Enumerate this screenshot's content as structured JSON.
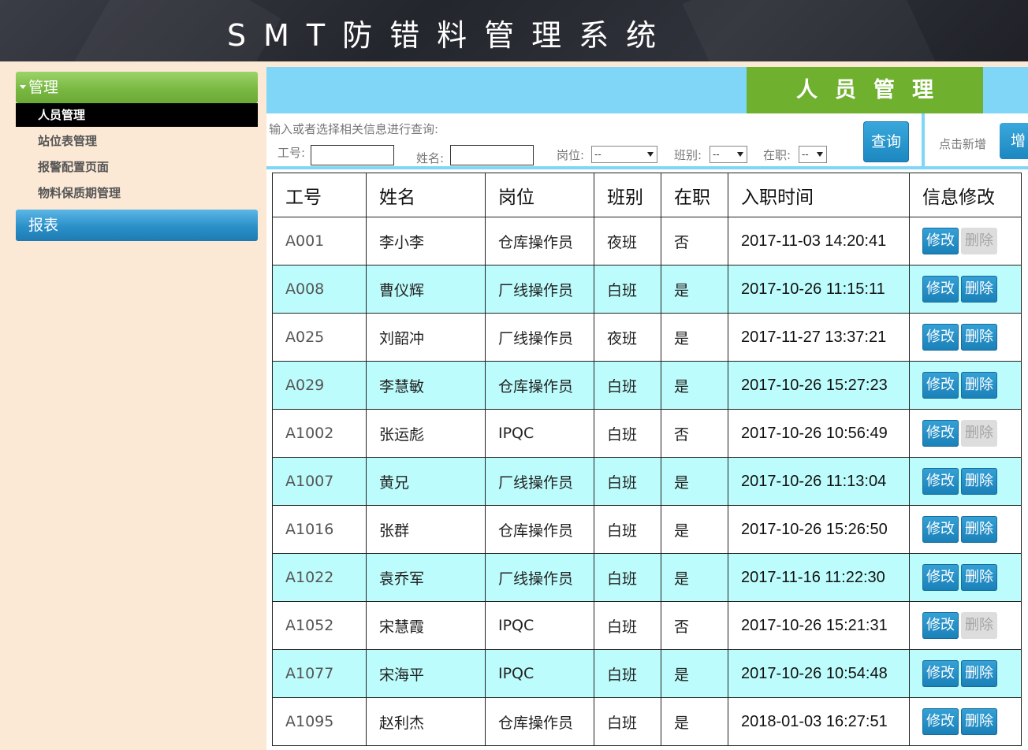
{
  "header": {
    "title": "SMT防错料管理系统"
  },
  "sidebar": {
    "groups": [
      {
        "label": "管理"
      },
      {
        "label": "报表"
      }
    ],
    "items": [
      {
        "label": "人员管理"
      },
      {
        "label": "站位表管理"
      },
      {
        "label": "报警配置页面"
      },
      {
        "label": "物料保质期管理"
      }
    ]
  },
  "main": {
    "title": "人员管理",
    "search": {
      "hint": "输入或者选择相关信息进行查询:",
      "id_label": "工号:",
      "name_label": "姓名:",
      "post_label": "岗位:",
      "post_value": "--",
      "shift_label": "班别:",
      "shift_value": "--",
      "employed_label": "在职:",
      "employed_value": "--",
      "query_button": "查询",
      "add_hint": "点击新增",
      "add_button": "增"
    },
    "table": {
      "headers": [
        "工号",
        "姓名",
        "岗位",
        "班别",
        "在职",
        "入职时间",
        "信息修改"
      ],
      "edit_label": "修改",
      "delete_label": "删除",
      "rows": [
        {
          "id": "A001",
          "name": "李小李",
          "post": "仓库操作员",
          "shift": "夜班",
          "employed": "否",
          "time": "2017-11-03 14:20:41",
          "delete_enabled": false
        },
        {
          "id": "A008",
          "name": "曹仪辉",
          "post": "厂线操作员",
          "shift": "白班",
          "employed": "是",
          "time": "2017-10-26 11:15:11",
          "delete_enabled": true
        },
        {
          "id": "A025",
          "name": "刘韶冲",
          "post": "厂线操作员",
          "shift": "夜班",
          "employed": "是",
          "time": "2017-11-27 13:37:21",
          "delete_enabled": true
        },
        {
          "id": "A029",
          "name": "李慧敏",
          "post": "仓库操作员",
          "shift": "白班",
          "employed": "是",
          "time": "2017-10-26 15:27:23",
          "delete_enabled": true
        },
        {
          "id": "A1002",
          "name": "张运彪",
          "post": "IPQC",
          "shift": "白班",
          "employed": "否",
          "time": "2017-10-26 10:56:49",
          "delete_enabled": false
        },
        {
          "id": "A1007",
          "name": "黄兄",
          "post": "厂线操作员",
          "shift": "白班",
          "employed": "是",
          "time": "2017-10-26 11:13:04",
          "delete_enabled": true
        },
        {
          "id": "A1016",
          "name": "张群",
          "post": "仓库操作员",
          "shift": "白班",
          "employed": "是",
          "time": "2017-10-26 15:26:50",
          "delete_enabled": true
        },
        {
          "id": "A1022",
          "name": "袁乔军",
          "post": "厂线操作员",
          "shift": "白班",
          "employed": "是",
          "time": "2017-11-16 11:22:30",
          "delete_enabled": true
        },
        {
          "id": "A1052",
          "name": "宋慧霞",
          "post": "IPQC",
          "shift": "白班",
          "employed": "否",
          "time": "2017-10-26 15:21:31",
          "delete_enabled": false
        },
        {
          "id": "A1077",
          "name": "宋海平",
          "post": "IPQC",
          "shift": "白班",
          "employed": "是",
          "time": "2017-10-26 10:54:48",
          "delete_enabled": true
        },
        {
          "id": "A1095",
          "name": "赵利杰",
          "post": "仓库操作员",
          "shift": "白班",
          "employed": "是",
          "time": "2018-01-03 16:27:51",
          "delete_enabled": true
        }
      ]
    }
  },
  "colors": {
    "header_bg": "#2b2d34",
    "page_bg": "#fbe9d6",
    "title_bar": "#7fd6f6",
    "title_box": "#6fb02f",
    "row_alt": "#bdfcfc",
    "button_blue": "#1c87c0"
  }
}
